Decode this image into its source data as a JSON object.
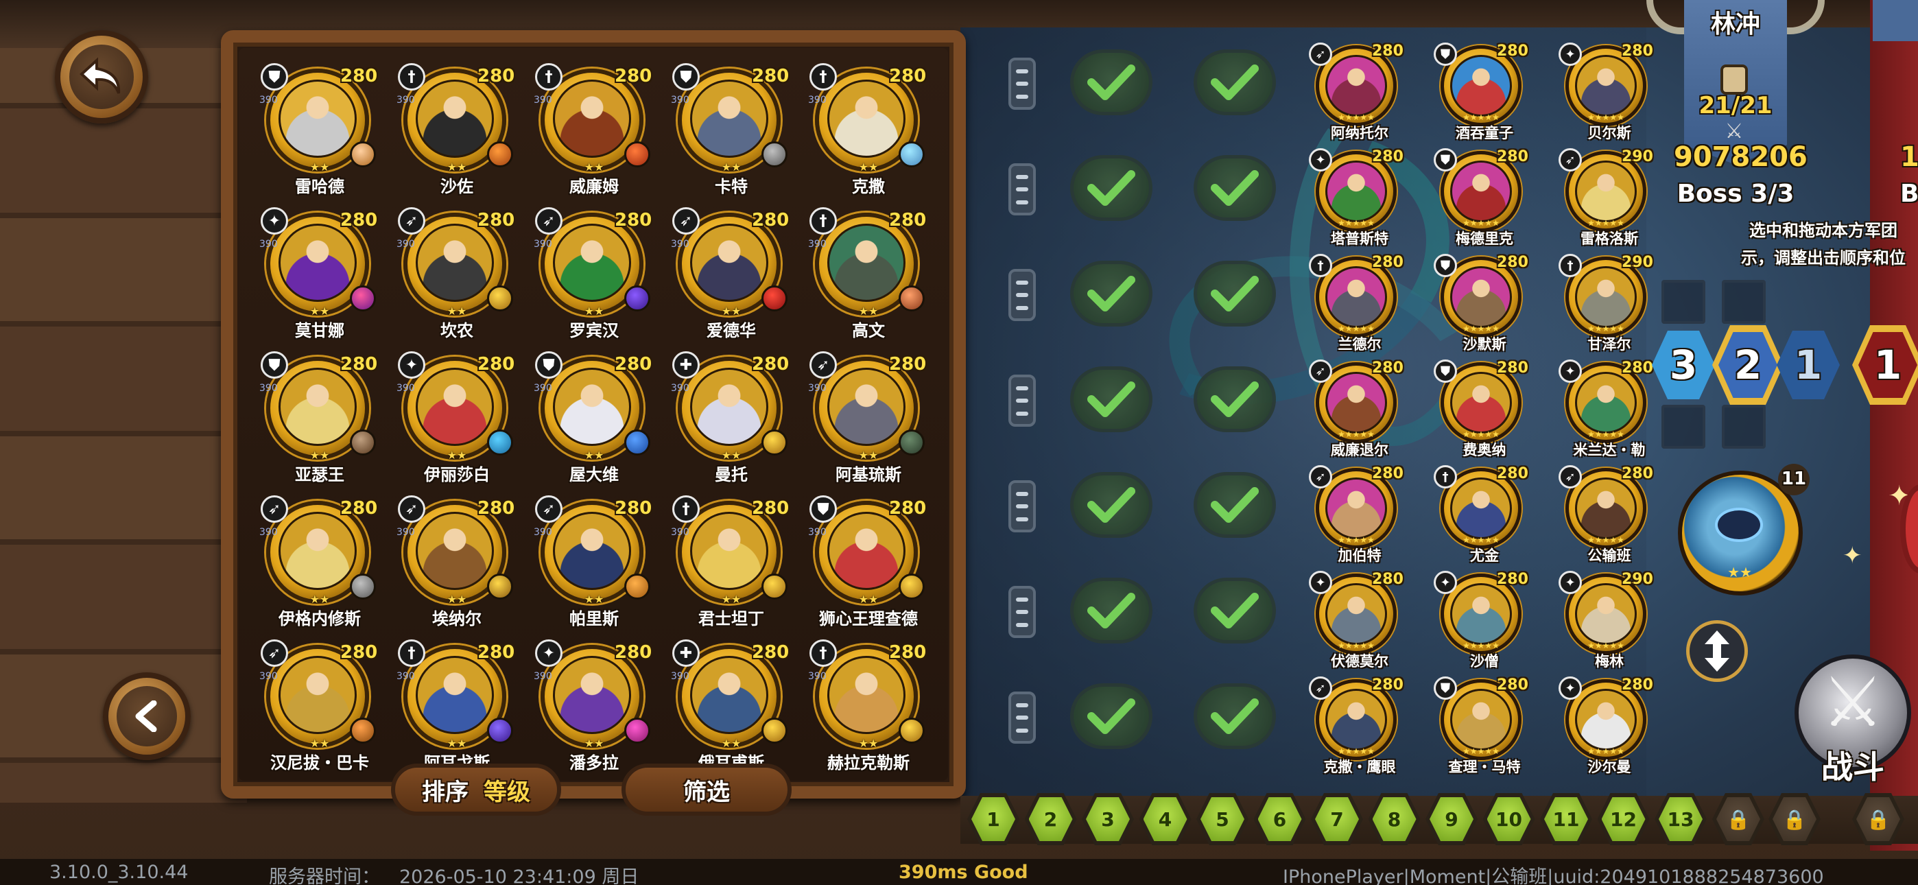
{
  "hero_list": [
    {
      "name": "雷哈德",
      "level": "280",
      "type": "shield",
      "sub": "390",
      "c1": "#c9c9c9",
      "c2": "#e2b23a",
      "g1": "#ffd0a0",
      "g2": "#b06a20"
    },
    {
      "name": "沙佐",
      "level": "280",
      "type": "sword",
      "sub": "390",
      "c1": "#2a2a2a",
      "c2": "#d2a028",
      "g1": "#ff9a3a",
      "g2": "#a04010"
    },
    {
      "name": "威廉姆",
      "level": "280",
      "type": "sword",
      "sub": "390",
      "c1": "#8a3a1a",
      "c2": "#d29a28",
      "g1": "#ff7a3a",
      "g2": "#a02a10"
    },
    {
      "name": "卡特",
      "level": "280",
      "type": "shield",
      "sub": "390",
      "c1": "#5a6a8a",
      "c2": "#d2a028",
      "g1": "#c0c0c0",
      "g2": "#5a5a5a"
    },
    {
      "name": "克撒",
      "level": "280",
      "type": "sword",
      "sub": "390",
      "c1": "#e8e0c8",
      "c2": "#d2a028",
      "g1": "#a0e8ff",
      "g2": "#4a8ac0"
    },
    {
      "name": "莫甘娜",
      "level": "280",
      "type": "magic",
      "sub": "390",
      "c1": "#6a2aa8",
      "c2": "#d2a028",
      "g1": "#ff5aa0",
      "g2": "#6a1a8a"
    },
    {
      "name": "坎农",
      "level": "280",
      "type": "bow",
      "sub": "390",
      "c1": "#3a3a3a",
      "c2": "#d2a028",
      "g1": "#ffd84a",
      "g2": "#a06a10"
    },
    {
      "name": "罗宾汉",
      "level": "280",
      "type": "bow",
      "sub": "390",
      "c1": "#2a8a3a",
      "c2": "#d2a028",
      "g1": "#8a5aff",
      "g2": "#3a1a8a"
    },
    {
      "name": "爱德华",
      "level": "280",
      "type": "bow",
      "sub": "390",
      "c1": "#3a3a5a",
      "c2": "#d2a028",
      "g1": "#ff4a3a",
      "g2": "#8a1010"
    },
    {
      "name": "高文",
      "level": "280",
      "type": "sword",
      "sub": "390",
      "c1": "#4a5a4a",
      "c2": "#3a7a5a",
      "g1": "#ffa06a",
      "g2": "#8a3a1a"
    },
    {
      "name": "亚瑟王",
      "level": "280",
      "type": "shield",
      "sub": "390",
      "c1": "#e8d27a",
      "c2": "#d2a028",
      "g1": "#c0a080",
      "g2": "#5a3a20"
    },
    {
      "name": "伊丽莎白",
      "level": "280",
      "type": "magic",
      "sub": "390",
      "c1": "#c83a3a",
      "c2": "#d2a028",
      "g1": "#5ad0ff",
      "g2": "#1a6aa0"
    },
    {
      "name": "屋大维",
      "level": "280",
      "type": "shield",
      "sub": "390",
      "c1": "#e8e8f0",
      "c2": "#d2a028",
      "g1": "#5aa0ff",
      "g2": "#1a4aa0"
    },
    {
      "name": "曼托",
      "level": "280",
      "type": "cross",
      "sub": "390",
      "c1": "#d8d8e8",
      "c2": "#d2a028",
      "g1": "#ffd84a",
      "g2": "#a06a10"
    },
    {
      "name": "阿基琉斯",
      "level": "280",
      "type": "bow",
      "sub": "390",
      "c1": "#6a6a7a",
      "c2": "#d2a028",
      "g1": "#6a8a6a",
      "g2": "#2a3a2a"
    },
    {
      "name": "伊格内修斯",
      "level": "280",
      "type": "bow",
      "sub": "390",
      "c1": "#e8d27a",
      "c2": "#d2a028",
      "g1": "#c0c0c0",
      "g2": "#5a5a5a"
    },
    {
      "name": "埃纳尔",
      "level": "280",
      "type": "bow",
      "sub": "390",
      "c1": "#8a5a2a",
      "c2": "#d2a028",
      "g1": "#ffd84a",
      "g2": "#8a5a10"
    },
    {
      "name": "帕里斯",
      "level": "280",
      "type": "bow",
      "sub": "390",
      "c1": "#2a3a6a",
      "c2": "#d2a028",
      "g1": "#ffb04a",
      "g2": "#a05a10"
    },
    {
      "name": "君士坦丁",
      "level": "280",
      "type": "sword",
      "sub": "390",
      "c1": "#e8c85a",
      "c2": "#d2a028",
      "g1": "#ffd84a",
      "g2": "#a06a10"
    },
    {
      "name": "狮心王理查德",
      "level": "280",
      "type": "shield",
      "sub": "390",
      "c1": "#c83a3a",
      "c2": "#d2a028",
      "g1": "#ffd84a",
      "g2": "#a06a10"
    },
    {
      "name": "汉尼拔・巴卡",
      "level": "280",
      "type": "bow",
      "sub": "390",
      "c1": "#c8a03a",
      "c2": "#d2a028",
      "g1": "#ffa04a",
      "g2": "#8a4a10"
    },
    {
      "name": "阿耳戈斯",
      "level": "280",
      "type": "sword",
      "sub": "390",
      "c1": "#3a5aa8",
      "c2": "#d2a028",
      "g1": "#8a6aff",
      "g2": "#3a1a8a"
    },
    {
      "name": "潘多拉",
      "level": "280",
      "type": "magic",
      "sub": "390",
      "c1": "#6a3aa8",
      "c2": "#d2a028",
      "g1": "#ff5ad0",
      "g2": "#8a1a6a"
    },
    {
      "name": "俄耳甫斯",
      "level": "280",
      "type": "cross",
      "sub": "390",
      "c1": "#3a5a8a",
      "c2": "#d2a028",
      "g1": "#ffd84a",
      "g2": "#a06a10"
    },
    {
      "name": "赫拉克勒斯",
      "level": "280",
      "type": "sword",
      "sub": "390",
      "c1": "#d29a4a",
      "c2": "#d2a028",
      "g1": "#ffd84a",
      "g2": "#a06a10"
    }
  ],
  "sort_button": {
    "label": "排序",
    "value": "等级"
  },
  "filter_button": {
    "label": "筛选"
  },
  "army": [
    {
      "name": "阿纳托尔",
      "level": "280",
      "type": "bow",
      "c1": "#8a2a4a",
      "c2": "#c8409a"
    },
    {
      "name": "酒吞童子",
      "level": "280",
      "type": "shield",
      "c1": "#c83a3a",
      "c2": "#3a8ad0"
    },
    {
      "name": "贝尔斯",
      "level": "280",
      "type": "magic",
      "c1": "#4a4a6a",
      "c2": "#d2a028"
    },
    {
      "name": "塔普斯特",
      "level": "280",
      "type": "magic",
      "c1": "#3a8a3a",
      "c2": "#c8409a"
    },
    {
      "name": "梅德里克",
      "level": "280",
      "type": "shield",
      "c1": "#a82a2a",
      "c2": "#c8409a"
    },
    {
      "name": "雷格洛斯",
      "level": "290",
      "type": "bow",
      "c1": "#e8d27a",
      "c2": "#d2a028"
    },
    {
      "name": "兰德尔",
      "level": "280",
      "type": "sword",
      "c1": "#5a5a6a",
      "c2": "#c8409a"
    },
    {
      "name": "沙默斯",
      "level": "280",
      "type": "shield",
      "c1": "#8a6a4a",
      "c2": "#c8409a"
    },
    {
      "name": "甘泽尔",
      "level": "290",
      "type": "sword",
      "c1": "#8a8a7a",
      "c2": "#d2a028"
    },
    {
      "name": "威廉退尔",
      "level": "280",
      "type": "bow",
      "c1": "#8a4a2a",
      "c2": "#c8409a"
    },
    {
      "name": "费奥纳",
      "level": "280",
      "type": "shield",
      "c1": "#c83a3a",
      "c2": "#d2a028"
    },
    {
      "name": "米兰达・勒",
      "level": "280",
      "type": "magic",
      "c1": "#3a8a5a",
      "c2": "#d2a028"
    },
    {
      "name": "加伯特",
      "level": "280",
      "type": "bow",
      "c1": "#c89a6a",
      "c2": "#c8409a"
    },
    {
      "name": "尤金",
      "level": "280",
      "type": "sword",
      "c1": "#3a4a8a",
      "c2": "#d2a028"
    },
    {
      "name": "公输班",
      "level": "280",
      "type": "bow",
      "c1": "#5a3a2a",
      "c2": "#d2a028"
    },
    {
      "name": "伏德莫尔",
      "level": "280",
      "type": "magic",
      "c1": "#6a7a8a",
      "c2": "#d2a028"
    },
    {
      "name": "沙僧",
      "level": "280",
      "type": "magic",
      "c1": "#5a8a9a",
      "c2": "#d2a028"
    },
    {
      "name": "梅林",
      "level": "290",
      "type": "magic",
      "c1": "#d8c8a8",
      "c2": "#d2a028"
    },
    {
      "name": "克撒・鹰眼",
      "level": "280",
      "type": "bow",
      "c1": "#3a4a6a",
      "c2": "#d2a028"
    },
    {
      "name": "查理・马特",
      "level": "280",
      "type": "shield",
      "c1": "#c8a04a",
      "c2": "#d2a028"
    },
    {
      "name": "沙尔曼",
      "level": "280",
      "type": "magic",
      "c1": "#e8e8e8",
      "c2": "#d2a028"
    }
  ],
  "commander": {
    "name": "林冲",
    "stamina": "21/21",
    "power": "9078206",
    "boss": "Boss 3/3",
    "partial_power": "1",
    "partial_boss": "B"
  },
  "hint": {
    "line1": "选中和拖动本方军团",
    "line2": "示，调整出击顺序和位"
  },
  "formation_order": [
    "3",
    "2",
    "1"
  ],
  "formation_partial": "1",
  "pet": {
    "level": "11",
    "stars": "★★"
  },
  "fight_button": {
    "label": "战斗"
  },
  "levels": [
    "1",
    "2",
    "3",
    "4",
    "5",
    "6",
    "7",
    "8",
    "9",
    "10",
    "11",
    "12",
    "13"
  ],
  "status": {
    "version": "3.10.0_3.10.44",
    "server_time_label": "服务器时间：",
    "server_time": "2026-05-10  23:41:09  周日",
    "ping": "390ms Good",
    "player": "IPhonePlayer|Moment|公输班|uuid:2049101888254873600"
  },
  "colors": {
    "accent_gold": "#ffd84a",
    "level_green": "#b6e04a",
    "panel_wood": "#7a4a24",
    "ping_yellow": "#e8c040"
  }
}
